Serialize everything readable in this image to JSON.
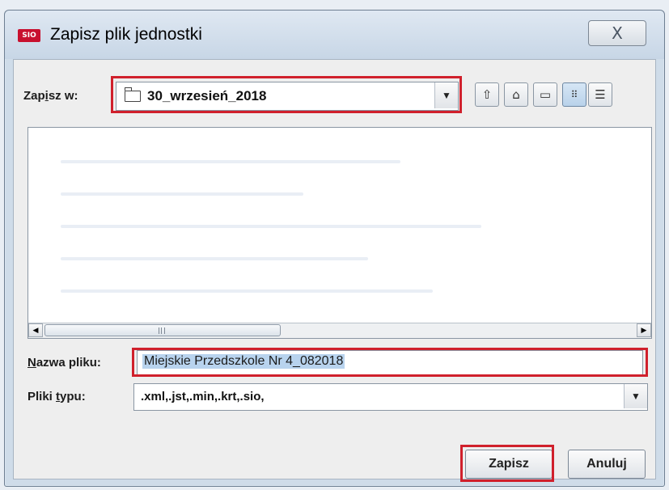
{
  "window": {
    "app_icon_text": "SIO",
    "title": "Zapisz plik jednostki",
    "close_glyph": "X"
  },
  "save_in": {
    "label_pre": "Zap",
    "label_accel": "i",
    "label_post": "sz w:",
    "value": "30_wrzesień_2018"
  },
  "toolbar": {
    "buttons": [
      "up-folder-icon",
      "home-icon",
      "new-folder-icon",
      "list-view-icon",
      "details-view-icon"
    ]
  },
  "file_name": {
    "label_accel": "N",
    "label_rest": "azwa pliku:",
    "value": "Miejskie Przedszkole Nr 4_082018"
  },
  "file_type": {
    "label_pre": "Pliki ",
    "label_accel": "t",
    "label_post": "ypu:",
    "value": ".xml,.jst,.min,.krt,.sio,"
  },
  "actions": {
    "save_label": "Zapisz",
    "cancel_label": "Anuluj"
  },
  "colors": {
    "highlight": "#d0202c",
    "selection": "#b8d3ee"
  }
}
